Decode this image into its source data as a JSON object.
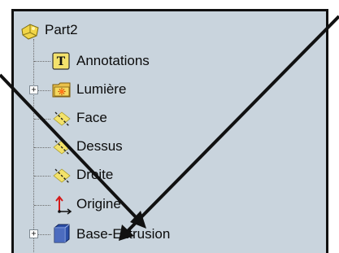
{
  "tree": {
    "root": {
      "label": "Part2",
      "icon": "part-icon"
    },
    "items": [
      {
        "label": "Annotations",
        "icon": "annotation-t-icon",
        "expandable": false
      },
      {
        "label": "Lumière",
        "icon": "lights-folder-icon",
        "expandable": true,
        "expander": "+"
      },
      {
        "label": "Face",
        "icon": "plane-icon",
        "expandable": false
      },
      {
        "label": "Dessus",
        "icon": "plane-icon",
        "expandable": false
      },
      {
        "label": "Droite",
        "icon": "plane-icon",
        "expandable": false
      },
      {
        "label": "Origine",
        "icon": "origin-axes-icon",
        "expandable": false
      },
      {
        "label": "Base-Extrusion",
        "icon": "extrusion-icon",
        "expandable": true,
        "expander": "+"
      }
    ]
  },
  "overlay": {
    "arrows": [
      "pointer-arrow-icon",
      "pointer-arrow-icon"
    ]
  },
  "colors": {
    "panel_bg": "#c9d4dd",
    "plane_yellow": "#f3e26a",
    "arrow": "#111111"
  }
}
